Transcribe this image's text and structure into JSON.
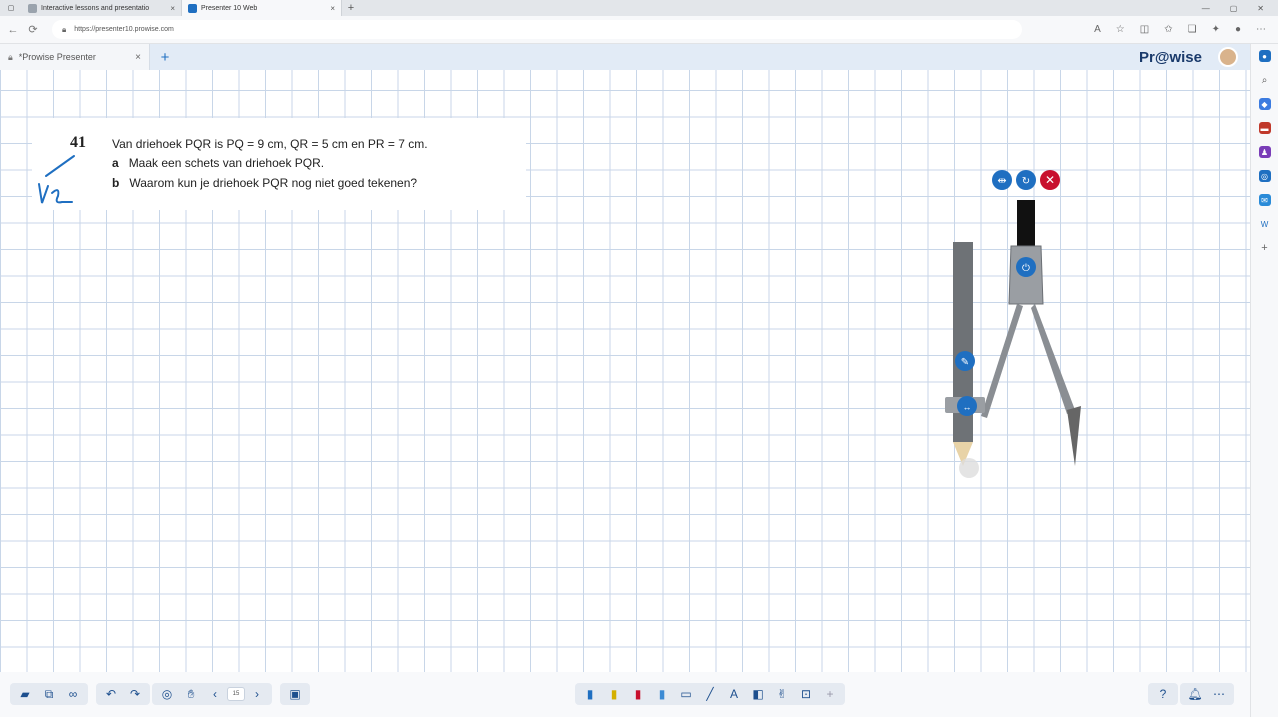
{
  "browser": {
    "tabs": [
      {
        "label": "Interactive lessons and presentatio",
        "active": false
      },
      {
        "label": "Presenter 10 Web",
        "active": true
      }
    ],
    "url": "https://presenter10.prowise.com"
  },
  "app": {
    "tab_label": "*Prowise Presenter",
    "brand": "Pr@wise"
  },
  "problem": {
    "number": "41",
    "intro": "Van driehoek PQR is PQ = 9 cm, QR = 5 cm en PR = 7 cm.",
    "part_a_label": "a",
    "part_a": "Maak een schets van driehoek PQR.",
    "part_b_label": "b",
    "part_b": "Waarom kun je driehoek PQR nog niet goed tekenen?"
  },
  "toolbar": {
    "page_number": "15"
  },
  "colors": {
    "accent": "#1f6fc1",
    "close_red": "#c8102e",
    "grid": "#c8d6e8",
    "app_bar": "#e2ebf6"
  }
}
